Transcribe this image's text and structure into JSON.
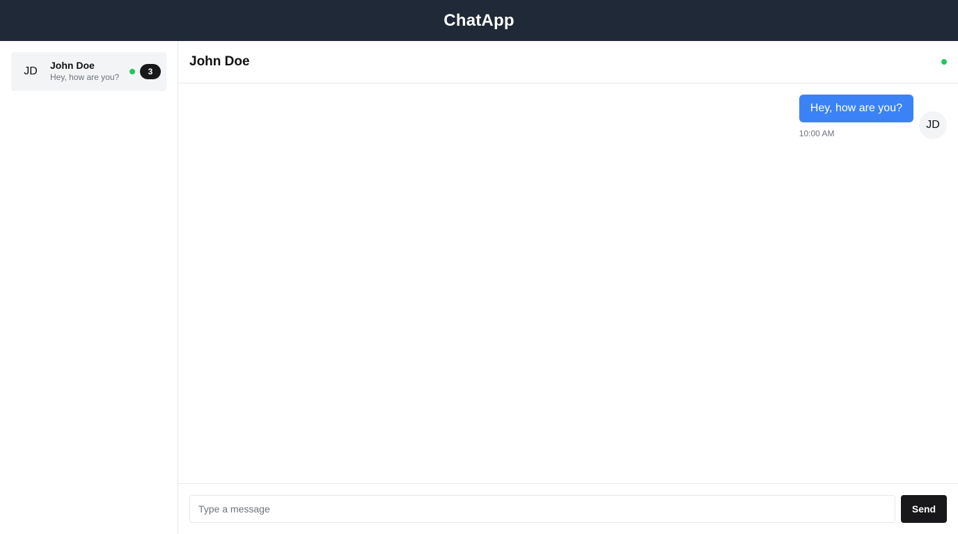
{
  "app": {
    "title": "ChatApp"
  },
  "sidebar": {
    "contacts": [
      {
        "initials": "JD",
        "name": "John Doe",
        "preview": "Hey, how are you?",
        "online": true,
        "unread_count": "3"
      }
    ]
  },
  "chat": {
    "header_name": "John Doe",
    "online": true,
    "messages": [
      {
        "text": "Hey, how are you?",
        "time": "10:00 AM",
        "avatar_initials": "JD"
      }
    ]
  },
  "composer": {
    "placeholder": "Type a message",
    "value": "",
    "send_label": "Send"
  },
  "colors": {
    "topbar": "#1f2937",
    "accent": "#3b82f6",
    "online": "#22c55e",
    "dark_button": "#18181b"
  }
}
